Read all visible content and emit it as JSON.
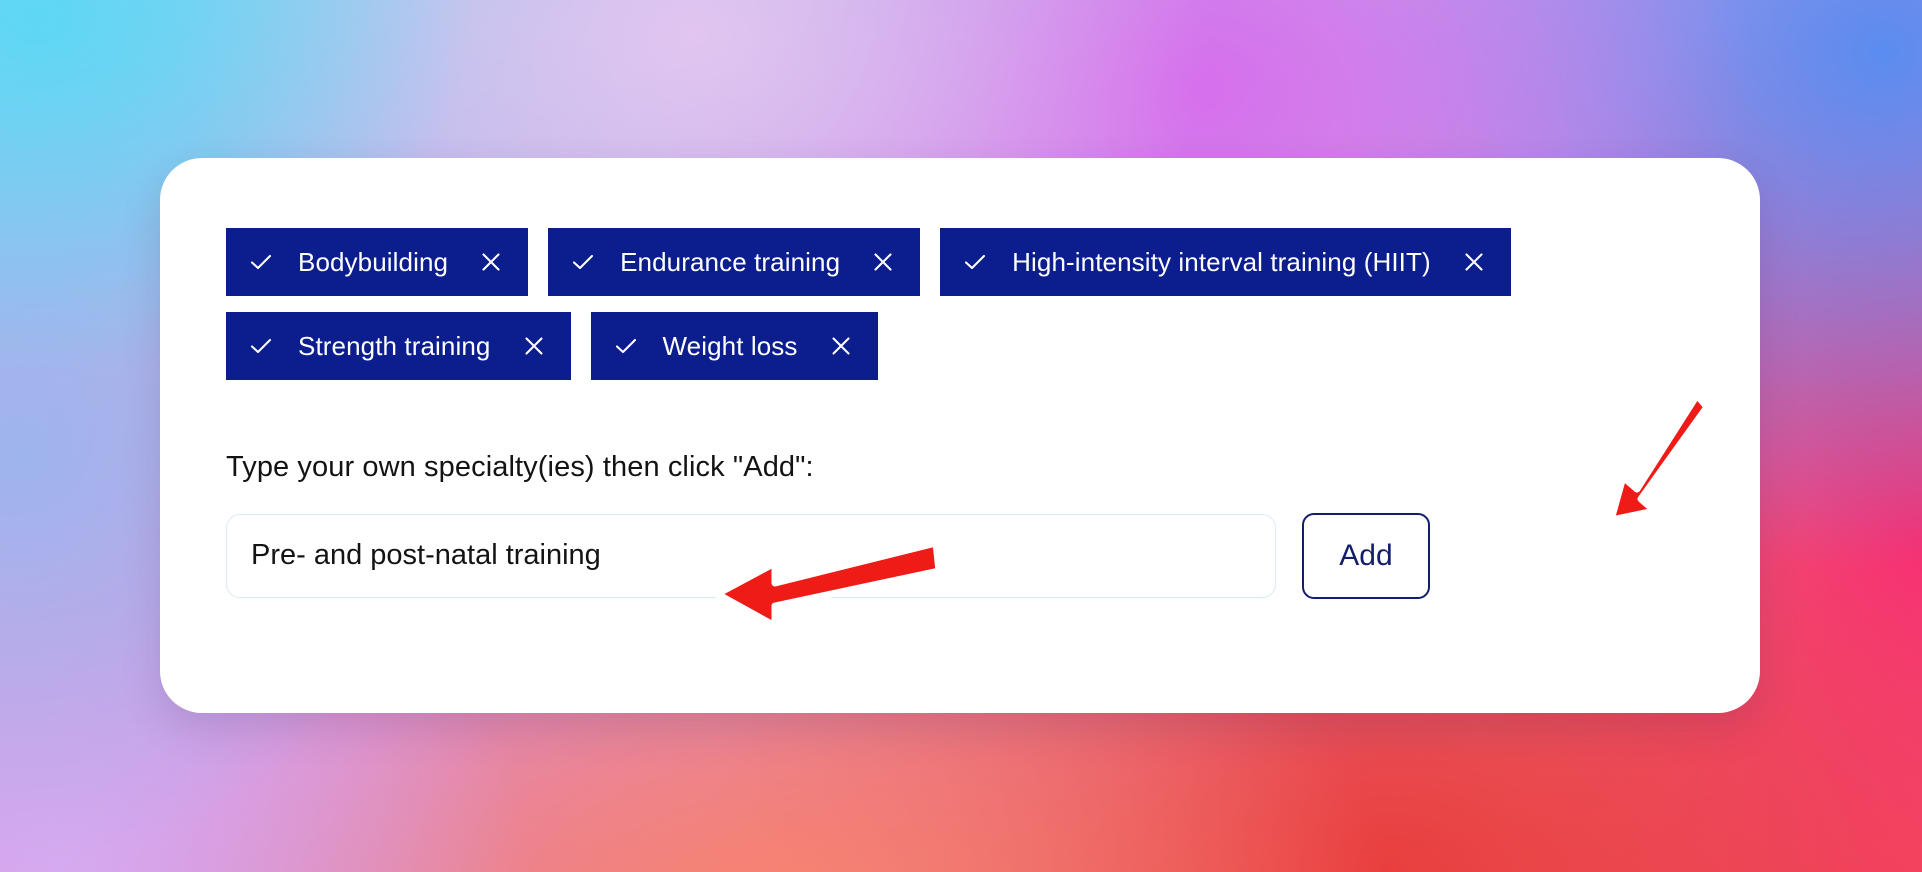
{
  "theme": {
    "chip_background": "#0c1d8d",
    "chip_text": "#ffffff",
    "card_background": "#ffffff",
    "button_border": "#121d6b",
    "button_text": "#121d6b",
    "input_border": "#d6edf3",
    "annotation_arrow": "#ee1b17",
    "annotation_arrow_outline": "#ffffff",
    "page_text": "#131313"
  },
  "background": {
    "description": "mesh-gradient",
    "stops": [
      "#5dd7f5",
      "#e2c5f0",
      "#d66eec",
      "#5a8cf0",
      "#9eb4ec",
      "#d6aaf0",
      "#f78470",
      "#e93e3e",
      "#f82f71"
    ]
  },
  "card": {
    "selected_specialties": [
      {
        "label": "Bodybuilding",
        "check_icon": "check-icon",
        "remove_icon": "close-icon",
        "selected": true,
        "row": 1
      },
      {
        "label": "Endurance training",
        "check_icon": "check-icon",
        "remove_icon": "close-icon",
        "selected": true,
        "row": 1
      },
      {
        "label": "High-intensity interval training (HIIT)",
        "check_icon": "check-icon",
        "remove_icon": "close-icon",
        "selected": true,
        "row": 1
      },
      {
        "label": "Strength training",
        "check_icon": "check-icon",
        "remove_icon": "close-icon",
        "selected": true,
        "row": 2
      },
      {
        "label": "Weight loss",
        "check_icon": "check-icon",
        "remove_icon": "close-icon",
        "selected": true,
        "row": 2
      }
    ],
    "prompt_label": "Type your own specialty(ies) then click \"Add\":",
    "input": {
      "value": "Pre- and post-natal training",
      "placeholder": ""
    },
    "add_button": {
      "label": "Add"
    }
  },
  "annotations": [
    {
      "name": "arrow-to-input",
      "icon": "arrow-left-icon",
      "points_to": "specialty-input",
      "color": "#ee1b17"
    },
    {
      "name": "arrow-to-add",
      "icon": "arrow-down-left-icon",
      "points_to": "add-button",
      "color": "#ee1b17"
    }
  ]
}
